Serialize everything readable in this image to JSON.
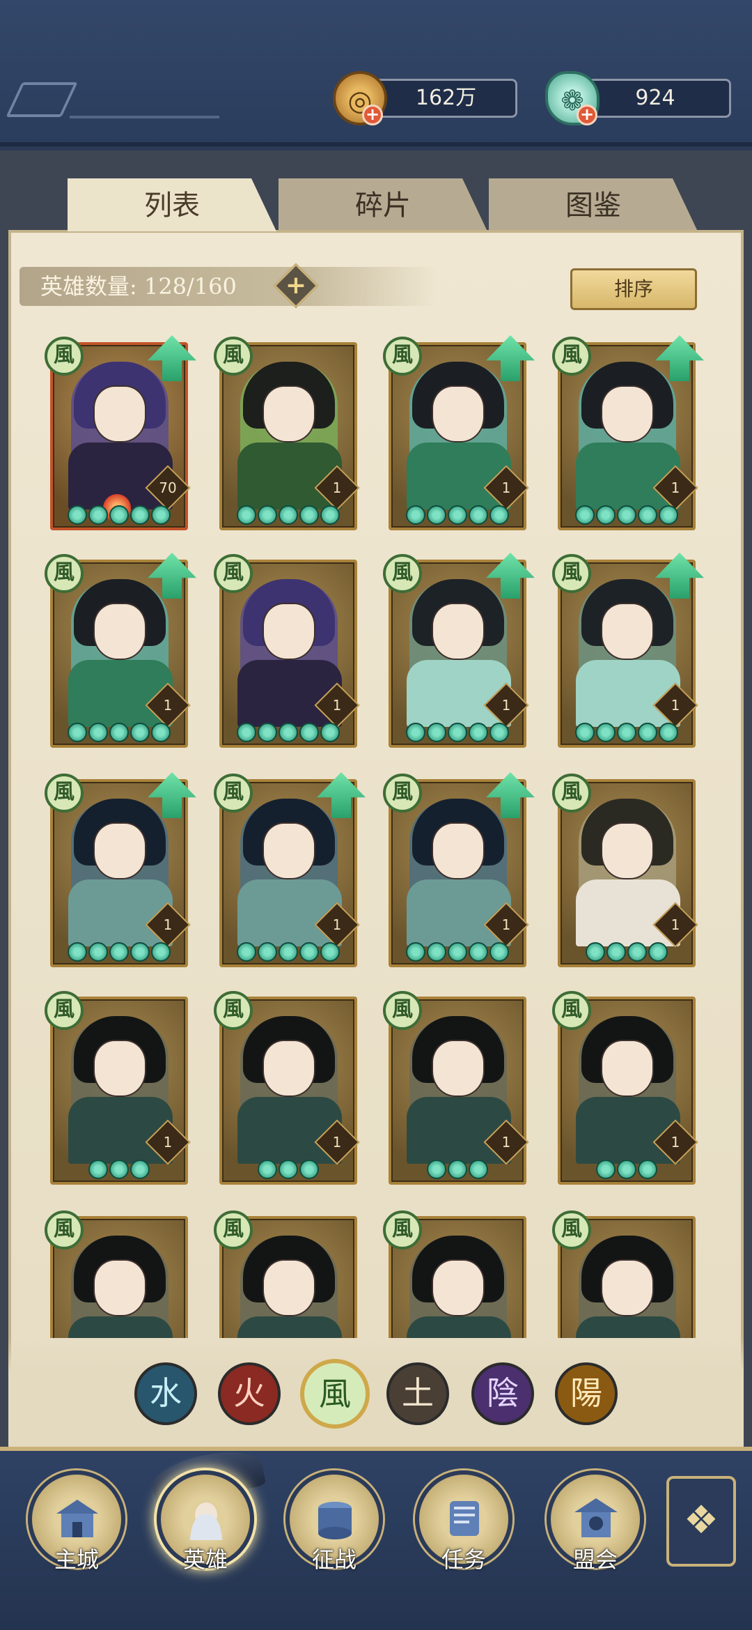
{
  "resources": {
    "coins": "162万",
    "jade": "924"
  },
  "tabs": [
    {
      "label": "列表",
      "active": true
    },
    {
      "label": "碎片",
      "active": false
    },
    {
      "label": "图鉴",
      "active": false
    }
  ],
  "hero_count": {
    "label": "英雄数量: 128/160"
  },
  "sort_button": "排序",
  "element_glyph": "風",
  "heroes": [
    {
      "level": "70",
      "stars": 5,
      "upgradable": true,
      "theme": "purple",
      "red": true
    },
    {
      "level": "1",
      "stars": 5,
      "upgradable": false,
      "theme": "green"
    },
    {
      "level": "1",
      "stars": 5,
      "upgradable": true,
      "theme": "teal"
    },
    {
      "level": "1",
      "stars": 5,
      "upgradable": true,
      "theme": "teal"
    },
    {
      "level": "1",
      "stars": 5,
      "upgradable": true,
      "theme": "teal"
    },
    {
      "level": "1",
      "stars": 5,
      "upgradable": false,
      "theme": "purple"
    },
    {
      "level": "1",
      "stars": 5,
      "upgradable": true,
      "theme": "mint"
    },
    {
      "level": "1",
      "stars": 5,
      "upgradable": true,
      "theme": "mint"
    },
    {
      "level": "1",
      "stars": 5,
      "upgradable": true,
      "theme": "slate"
    },
    {
      "level": "1",
      "stars": 5,
      "upgradable": true,
      "theme": "slate"
    },
    {
      "level": "1",
      "stars": 5,
      "upgradable": true,
      "theme": "slate"
    },
    {
      "level": "1",
      "stars": 4,
      "upgradable": false,
      "theme": "fur"
    },
    {
      "level": "1",
      "stars": 3,
      "upgradable": false,
      "theme": "dark"
    },
    {
      "level": "1",
      "stars": 3,
      "upgradable": false,
      "theme": "dark"
    },
    {
      "level": "1",
      "stars": 3,
      "upgradable": false,
      "theme": "dark"
    },
    {
      "level": "1",
      "stars": 3,
      "upgradable": false,
      "theme": "dark"
    },
    {
      "level": "",
      "stars": 0,
      "upgradable": false,
      "theme": "dark"
    },
    {
      "level": "",
      "stars": 0,
      "upgradable": false,
      "theme": "dark"
    },
    {
      "level": "",
      "stars": 0,
      "upgradable": false,
      "theme": "dark"
    },
    {
      "level": "",
      "stars": 0,
      "upgradable": false,
      "theme": "dark"
    }
  ],
  "element_filters": [
    {
      "name": "water",
      "glyph": "水"
    },
    {
      "name": "fire",
      "glyph": "火"
    },
    {
      "name": "wind",
      "glyph": "風",
      "active": true
    },
    {
      "name": "earth",
      "glyph": "土"
    },
    {
      "name": "yin",
      "glyph": "陰"
    },
    {
      "name": "yang",
      "glyph": "陽"
    }
  ],
  "nav": [
    {
      "label": "主城",
      "icon": "city-gate-icon"
    },
    {
      "label": "英雄",
      "icon": "hero-portrait-icon",
      "active": true
    },
    {
      "label": "征战",
      "icon": "battle-drum-icon"
    },
    {
      "label": "任务",
      "icon": "scroll-icon"
    },
    {
      "label": "盟会",
      "icon": "alliance-pavilion-icon"
    }
  ],
  "colors": {
    "accent_gold": "#c9b27a",
    "nav_bg": "#2f4265",
    "upgrade_green": "#2aa06b"
  }
}
